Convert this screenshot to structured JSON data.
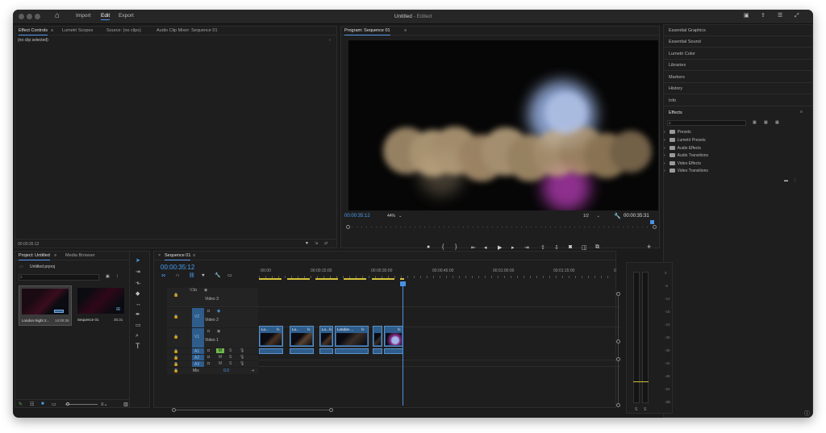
{
  "window": {
    "title": "Untitled",
    "status": " - Edited",
    "menu": [
      "Import",
      "Edit",
      "Export"
    ],
    "active_menu": "Edit"
  },
  "source_panel": {
    "tabs": [
      "Effect Controls",
      "Lumetri Scopes",
      "Source: (no clips)",
      "Audio Clip Mixer: Sequence 01"
    ],
    "message": "(no clip selected)",
    "timecode": "00:00:35:12"
  },
  "program_monitor": {
    "tab": "Program: Sequence 01",
    "timecode": "00:00:35:12",
    "zoom": "44%",
    "resolution": "1/2",
    "duration": "00:00:35:31"
  },
  "right_panels": {
    "items": [
      "Essential Graphics",
      "Essential Sound",
      "Lumetri Color",
      "Libraries",
      "Markers",
      "History",
      "Info"
    ],
    "effects_title": "Effects",
    "effects_folders": [
      "Presets",
      "Lumetri Presets",
      "Audio Effects",
      "Audio Transitions",
      "Video Effects",
      "Video Transitions"
    ]
  },
  "project_panel": {
    "tabs": [
      "Project: Untitled",
      "Media Browser"
    ],
    "file": "Untitled.prproj",
    "items": [
      {
        "name": "London Night 2...",
        "duration": "14:00:26"
      },
      {
        "name": "Sequence 01",
        "duration": "35:31"
      }
    ]
  },
  "timeline": {
    "tab": "Sequence 01",
    "timecode": "00:00:35:12",
    "ruler": [
      ":00:00",
      "00:00:15:00",
      "00:00:30:00",
      "00:00:45:00",
      "00:01:00:00",
      "00:01:15:00",
      "0"
    ],
    "video_tracks": [
      {
        "id": "V3",
        "name": "Video 3"
      },
      {
        "id": "V2",
        "name": "Video 2"
      },
      {
        "id": "V1",
        "name": "Video 1"
      }
    ],
    "audio_tracks": [
      {
        "id": "A1",
        "m": "M",
        "s": "S"
      },
      {
        "id": "A2",
        "m": "M",
        "s": "S"
      },
      {
        "id": "A3",
        "m": "M",
        "s": "S"
      }
    ],
    "mix_label": "Mix",
    "mix_value": "0.0",
    "clips": [
      "Lo...",
      "Lo...",
      "Lo...",
      "London ..."
    ],
    "fx": "fx"
  },
  "audio_meter": {
    "scale": [
      "0",
      "-6",
      "-12",
      "-18",
      "-24",
      "-30",
      "-36",
      "-42",
      "-48",
      "-54",
      "-dB"
    ],
    "channels": [
      "S",
      "S"
    ]
  },
  "colors": {
    "accent": "#4a9ff5",
    "clip": "#2e5d8c",
    "playhead": "#4a90e2",
    "audio_clip_active": "#6fb84a"
  }
}
